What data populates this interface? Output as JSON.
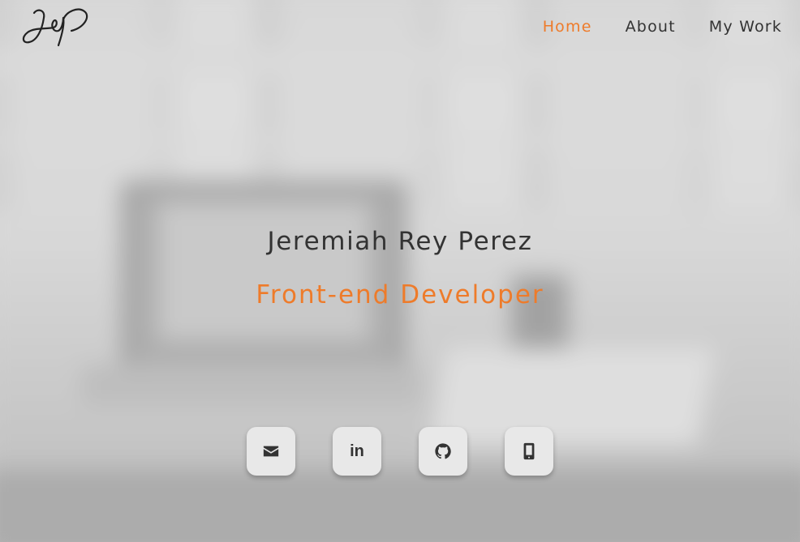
{
  "nav": {
    "items": [
      {
        "label": "Home",
        "active": true
      },
      {
        "label": "About",
        "active": false
      },
      {
        "label": "My Work",
        "active": false
      }
    ]
  },
  "hero": {
    "name": "Jeremiah Rey Perez",
    "title": "Front-end Developer"
  },
  "social": {
    "buttons": [
      {
        "icon": "envelope-icon"
      },
      {
        "icon": "linkedin-icon",
        "glyph": "in"
      },
      {
        "icon": "github-icon"
      },
      {
        "icon": "mobile-phone-icon"
      }
    ]
  },
  "colors": {
    "accent": "#ee7b2a",
    "text": "#333333",
    "button_bg": "#e8e8e8"
  }
}
